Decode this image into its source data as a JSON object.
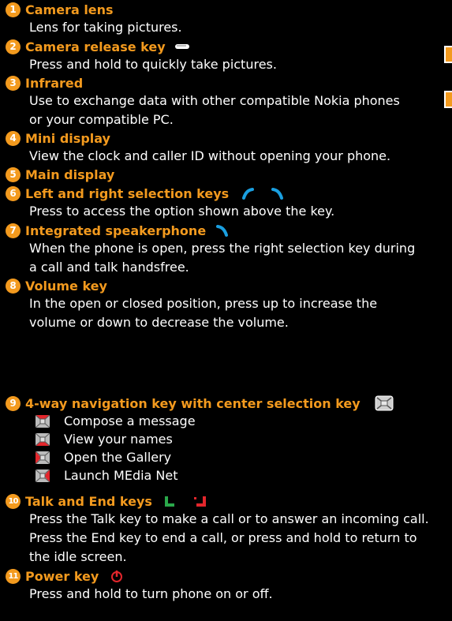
{
  "items": [
    {
      "num": "1",
      "title": "Camera lens",
      "desc": [
        "Lens for taking pictures."
      ]
    },
    {
      "num": "2",
      "title": "Camera release key",
      "icon": "camera-key-icon",
      "desc": [
        "Press and hold to quickly take pictures."
      ]
    },
    {
      "num": "3",
      "title": "Infrared",
      "desc": [
        "Use to exchange data with other compatible Nokia phones",
        "or your compatible PC."
      ]
    },
    {
      "num": "4",
      "title": "Mini display",
      "desc": [
        "View the clock and caller ID without opening your phone."
      ]
    },
    {
      "num": "5",
      "title": "Main display",
      "desc": []
    },
    {
      "num": "6",
      "title": "Left and right selection keys",
      "icon": "selection-keys-icon",
      "desc": [
        "Press to access the option shown above the key."
      ]
    },
    {
      "num": "7",
      "title": "Integrated speakerphone",
      "icon": "right-selection-key-icon",
      "desc": [
        "When the phone is open, press the right selection key during",
        "a call and talk handsfree."
      ]
    },
    {
      "num": "8",
      "title": "Volume key",
      "desc": [
        "In the open or closed position, press up to increase the",
        "volume or down to decrease the volume."
      ]
    },
    {
      "num": "9",
      "title": "4-way navigation key with center selection key",
      "icon": "navigation-key-icon",
      "nav": [
        "Compose a message",
        "View your names",
        "Open the Gallery",
        "Launch MEdia Net"
      ]
    },
    {
      "num": "10",
      "title": "Talk and End keys",
      "icon": "talk-end-keys-icon",
      "desc": [
        "Press the Talk key to make a call or to answer an incoming call.",
        "Press the End key to end a call, or press and hold to return to",
        "the idle screen."
      ]
    },
    {
      "num": "11",
      "title": "Power key",
      "icon": "power-key-icon",
      "desc": [
        "Press and hold to turn phone on or off."
      ]
    }
  ],
  "colors": {
    "accent": "#f39a1e",
    "selection_key": "#1a9fe0",
    "talk": "#2aa84a",
    "end": "#e3262c",
    "background": "#000000"
  }
}
